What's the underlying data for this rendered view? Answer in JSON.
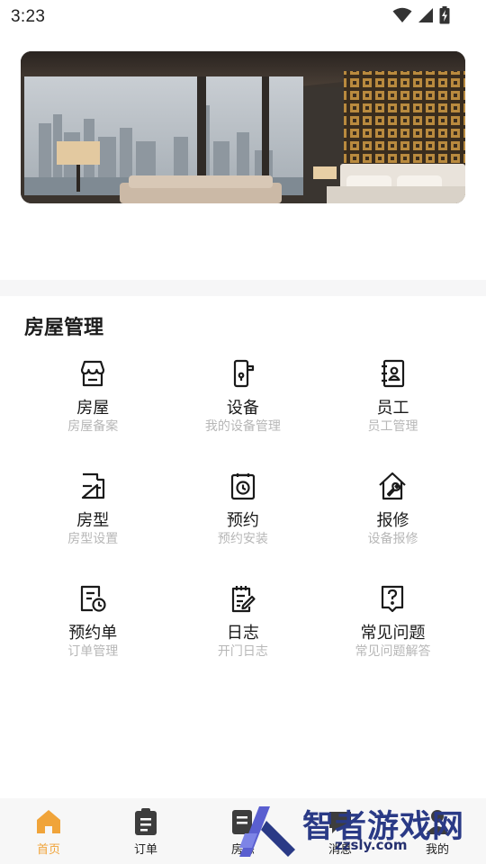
{
  "status_bar": {
    "time": "3:23",
    "icons": [
      "wifi-icon",
      "signal-icon",
      "battery-charging-icon"
    ]
  },
  "banner": {
    "image": "hotel room with skyline window view"
  },
  "section": {
    "title": "房屋管理"
  },
  "grid": [
    {
      "icon": "store-icon",
      "label": "房屋",
      "sub": "房屋备案"
    },
    {
      "icon": "door-lock-icon",
      "label": "设备",
      "sub": "我的设备管理"
    },
    {
      "icon": "contact-book-icon",
      "label": "员工",
      "sub": "员工管理"
    },
    {
      "icon": "floor-plan-icon",
      "label": "房型",
      "sub": "房型设置"
    },
    {
      "icon": "appointment-clock-icon",
      "label": "预约",
      "sub": "预约安装"
    },
    {
      "icon": "repair-wrench-icon",
      "label": "报修",
      "sub": "设备报修"
    },
    {
      "icon": "document-clock-icon",
      "label": "预约单",
      "sub": "订单管理"
    },
    {
      "icon": "notepad-edit-icon",
      "label": "日志",
      "sub": "开门日志"
    },
    {
      "icon": "question-icon",
      "label": "常见问题",
      "sub": "常见问题解答"
    }
  ],
  "tabbar": {
    "tabs": [
      {
        "icon": "home-icon",
        "label": "首页",
        "active": true
      },
      {
        "icon": "clipboard-icon",
        "label": "订单",
        "active": false
      },
      {
        "icon": "room-status-icon",
        "label": "房态",
        "active": false
      },
      {
        "icon": "message-icon",
        "label": "消息",
        "active": false
      },
      {
        "icon": "profile-icon",
        "label": "我的",
        "active": false
      }
    ]
  },
  "watermark": {
    "title": "智者游戏网",
    "url": "zzsly.com"
  },
  "colors": {
    "accent": "#f0a43a",
    "text": "#1a1a1a",
    "subtext": "#b7b7b7",
    "band": "#f6f6f7",
    "tabbar": "#f7f7f7",
    "watermark": "#2a3a86"
  }
}
